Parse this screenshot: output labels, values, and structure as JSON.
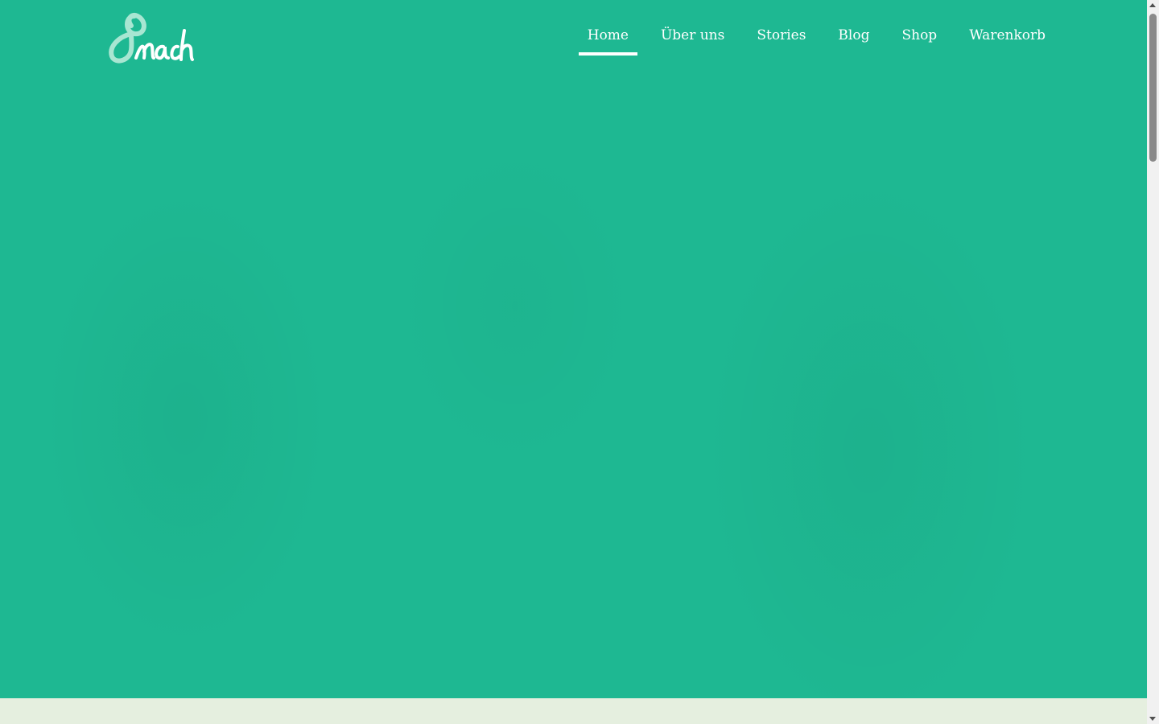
{
  "brand": {
    "logo_text": "8nach",
    "logo_color": "#a8e6d2"
  },
  "nav": {
    "items": [
      {
        "label": "Home",
        "active": true
      },
      {
        "label": "Über uns",
        "active": false
      },
      {
        "label": "Stories",
        "active": false
      },
      {
        "label": "Blog",
        "active": false
      },
      {
        "label": "Shop",
        "active": false
      },
      {
        "label": "Warenkorb",
        "active": false
      }
    ]
  },
  "colors": {
    "hero_background": "#1eb892",
    "band_background": "#e5efdf",
    "nav_text": "#ffffff"
  }
}
